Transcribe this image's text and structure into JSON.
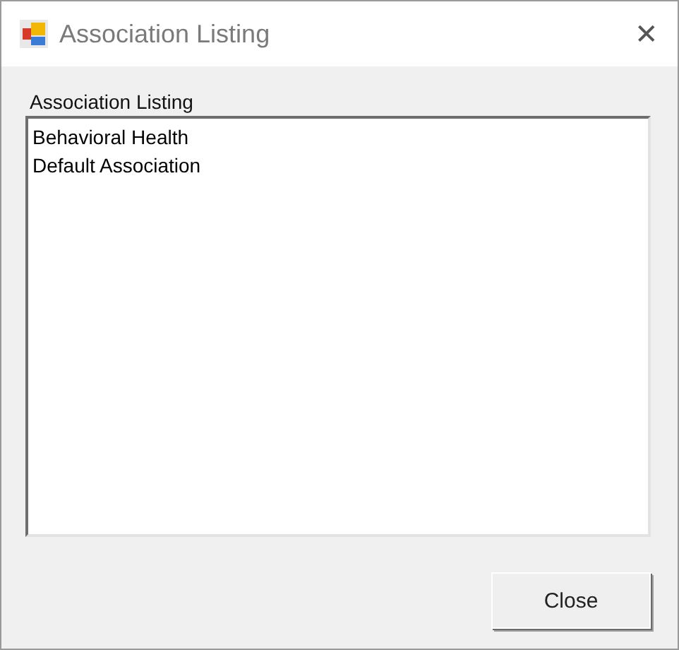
{
  "window": {
    "title": "Association Listing",
    "close_glyph": "✕"
  },
  "list": {
    "label": "Association Listing",
    "items": [
      "Behavioral Health",
      "Default Association"
    ]
  },
  "buttons": [
    "Close"
  ]
}
